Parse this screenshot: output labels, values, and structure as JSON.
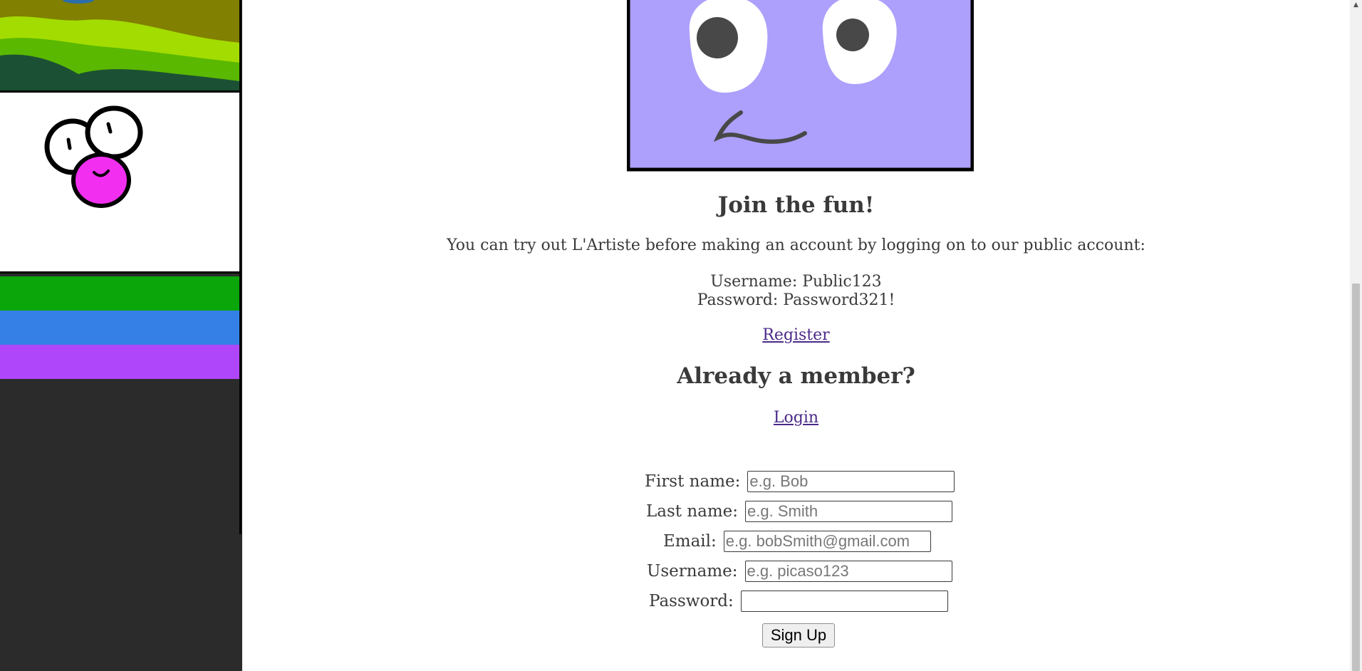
{
  "signup": {
    "heading": "Join the fun!",
    "intro": "You can try out L'Artiste before making an account by logging on to our public account:",
    "public_username": "Username: Public123",
    "public_password": "Password: Password321!",
    "register_link": "Register"
  },
  "login": {
    "heading": "Already a member?",
    "link": "Login"
  },
  "form": {
    "first_name_label": "First name:",
    "first_name_placeholder": "e.g. Bob",
    "last_name_label": "Last name:",
    "last_name_placeholder": "e.g. Smith",
    "email_label": "Email:",
    "email_placeholder": "e.g. bobSmith@gmail.com",
    "username_label": "Username:",
    "username_placeholder": "e.g. picaso123",
    "password_label": "Password:",
    "password_placeholder": "",
    "submit_label": "Sign Up"
  },
  "colors": {
    "avatar_fill": "#aca0fc",
    "blob_pink": "#f22ff0",
    "stripe_green": "#0aa60a",
    "stripe_blue": "#3580e6",
    "stripe_purple": "#b046fa",
    "sidebar_bg": "#2b2b2b"
  },
  "icons": [
    "landscape-painting-thumbnail",
    "blob-creature-thumbnail",
    "purple-face-avatar"
  ]
}
